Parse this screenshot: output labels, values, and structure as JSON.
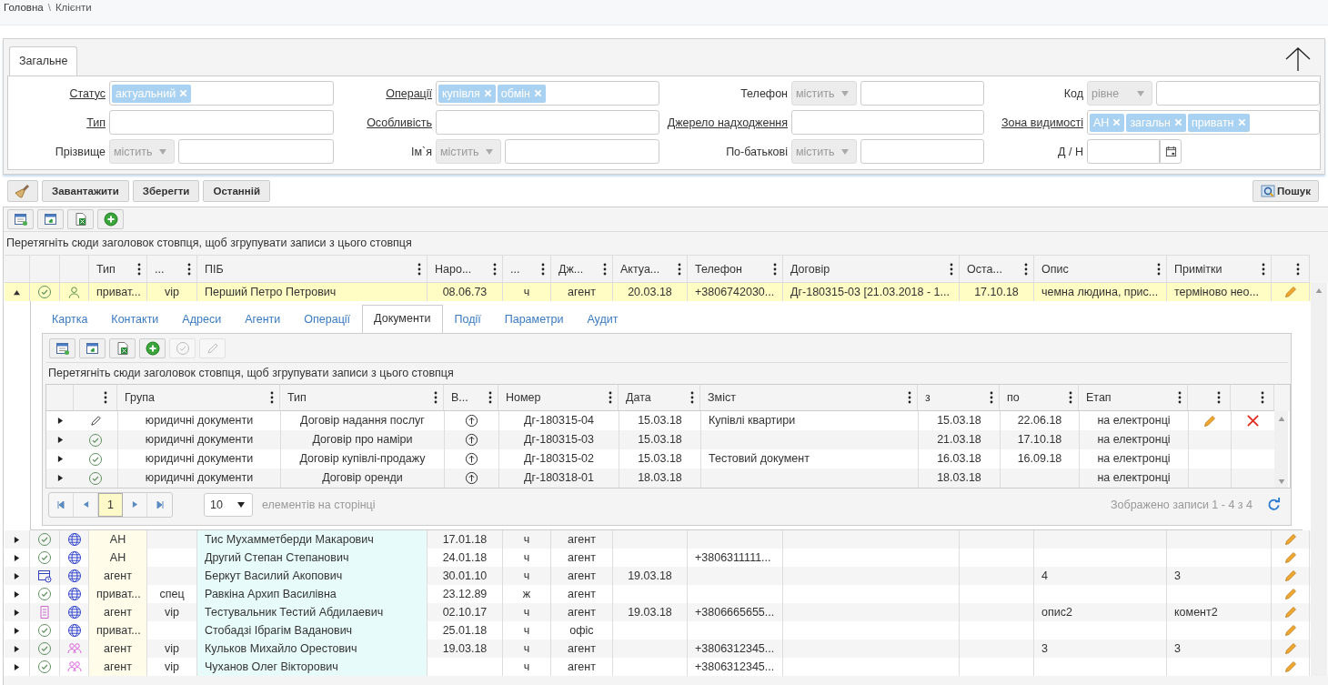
{
  "breadcrumb": [
    {
      "text": "Головна",
      "kind": "link"
    },
    {
      "text": "\\",
      "kind": "separator"
    },
    {
      "text": "Клієнти",
      "kind": "current"
    }
  ],
  "filter": {
    "tab": "Загальне",
    "fields": [
      {
        "label": "Статус",
        "link": true,
        "kind": "tags",
        "tags": [
          "актуальний"
        ]
      },
      {
        "label": "Операції",
        "link": true,
        "kind": "tags",
        "tags": [
          "купівля",
          "обмін"
        ]
      },
      {
        "label": "Телефон",
        "link": false,
        "kind": "op",
        "op": "містить"
      },
      {
        "label": "Код",
        "link": false,
        "kind": "op",
        "op": "рівне"
      },
      {
        "label": "Тип",
        "link": true,
        "kind": "text"
      },
      {
        "label": "Особливість",
        "link": true,
        "kind": "text"
      },
      {
        "label": "Джерело надходження",
        "link": true,
        "kind": "text"
      },
      {
        "label": "Зона видимості",
        "link": true,
        "kind": "tags",
        "tags": [
          "АН",
          "загальн",
          "приватн"
        ]
      },
      {
        "label": "Прізвище",
        "link": false,
        "kind": "op",
        "op": "містить"
      },
      {
        "label": "Ім`я",
        "link": false,
        "kind": "op",
        "op": "містить"
      },
      {
        "label": "По-батькові",
        "link": false,
        "kind": "op",
        "op": "містить"
      },
      {
        "label": "Д / Н",
        "link": false,
        "kind": "date"
      }
    ]
  },
  "actions": {
    "buttons": [
      "Завантажити",
      "Зберегти",
      "Останній"
    ],
    "search": "Пошук"
  },
  "toolbar": [
    {
      "kind": "settings"
    },
    {
      "kind": "add-window"
    },
    {
      "kind": "excel"
    },
    {
      "kind": "add"
    }
  ],
  "group_hint": "Перетягніть сюди заголовок стовпця, щоб згрупувати записи з цього стовпця",
  "columns": [
    "Тип",
    "...",
    "ПІБ",
    "Наро...",
    "...",
    "Дж...",
    "Актуа...",
    "Телефон",
    "Договір",
    "Оста...",
    "Опис",
    "Примітки"
  ],
  "rows": [
    {
      "selected": true,
      "expanded": true,
      "status": {
        "kind": "check"
      },
      "avatar": {
        "kind": "person"
      },
      "cells": [
        "приват...",
        "vip",
        "Перший Петро Петрович",
        "08.06.73",
        "ч",
        "агент",
        "20.03.18",
        "+3806742030...",
        "Дг-180315-03 [21.03.2018 - 1...",
        "17.10.18",
        "чемна людина, прис...",
        "терміново нео..."
      ],
      "detail": {
        "tabs": [
          {
            "label": "Картка",
            "selected": false
          },
          {
            "label": "Контакти",
            "selected": false
          },
          {
            "label": "Адреси",
            "selected": false
          },
          {
            "label": "Агенти",
            "selected": false
          },
          {
            "label": "Операції",
            "selected": false
          },
          {
            "label": "Документи",
            "selected": true
          },
          {
            "label": "Події",
            "selected": false
          },
          {
            "label": "Параметри",
            "selected": false
          },
          {
            "label": "Аудит",
            "selected": false
          }
        ],
        "toolbar": [
          {
            "kind": "settings",
            "disabled": false
          },
          {
            "kind": "add-window",
            "disabled": false
          },
          {
            "kind": "excel",
            "disabled": false
          },
          {
            "kind": "add",
            "disabled": false
          },
          {
            "kind": "approve",
            "disabled": true
          },
          {
            "kind": "edit",
            "disabled": true
          }
        ],
        "group_hint": "Перетягніть сюди заголовок стовпця, щоб згрупувати записи з цього стовпця",
        "columns": [
          "Група",
          "Тип",
          "В...",
          "Номер",
          "Дата",
          "Зміст",
          "з",
          "по",
          "Етап"
        ],
        "rows": [
          {
            "status": {
              "kind": "edit"
            },
            "actions": true,
            "cells": [
              "юридичні документи",
              "Договір надання послуг",
              "",
              "Дг-180315-04",
              "15.03.18",
              "Купівлі квартири",
              "15.03.18",
              "22.06.18",
              "на електронці"
            ]
          },
          {
            "status": {
              "kind": "check"
            },
            "actions": false,
            "cells": [
              "юридичні документи",
              "Договір про наміри",
              "",
              "Дг-180315-03",
              "15.03.18",
              "",
              "21.03.18",
              "17.10.18",
              "на електронці"
            ]
          },
          {
            "status": {
              "kind": "check"
            },
            "actions": false,
            "cells": [
              "юридичні документи",
              "Договір купівлі-продажу",
              "",
              "Дг-180315-02",
              "15.03.18",
              "Тестовий документ",
              "16.03.18",
              "16.09.18",
              "на електронці"
            ]
          },
          {
            "status": {
              "kind": "check"
            },
            "actions": false,
            "cells": [
              "юридичні документи",
              "Договір оренди",
              "",
              "Дг-180318-01",
              "18.03.18",
              "",
              "18.03.18",
              "",
              "на електронці"
            ]
          }
        ],
        "pager": {
          "page": "1",
          "size": "10",
          "size_label": "елементів на сторінці",
          "summary": "Зображено записи 1 - 4 з 4"
        }
      }
    },
    {
      "selected": false,
      "expanded": false,
      "status": {
        "kind": "check"
      },
      "avatar": {
        "kind": "globe"
      },
      "cells": [
        "АН",
        "",
        "Тис Мухамметберди Макарович",
        "17.01.18",
        "ч",
        "агент",
        "",
        "",
        "",
        "",
        "",
        ""
      ]
    },
    {
      "selected": false,
      "expanded": false,
      "status": {
        "kind": "check"
      },
      "avatar": {
        "kind": "globe"
      },
      "cells": [
        "АН",
        "",
        "Другий Степан Степанович",
        "24.01.18",
        "ч",
        "агент",
        "",
        "+3806311111...",
        "",
        "",
        "",
        ""
      ]
    },
    {
      "selected": false,
      "expanded": false,
      "status": {
        "kind": "calendar"
      },
      "avatar": {
        "kind": "globe"
      },
      "cells": [
        "агент",
        "",
        "Беркут Василий Акопович",
        "30.01.10",
        "ч",
        "агент",
        "19.03.18",
        "",
        "",
        "",
        "4",
        "3"
      ]
    },
    {
      "selected": false,
      "expanded": false,
      "status": {
        "kind": "check"
      },
      "avatar": {
        "kind": "globe"
      },
      "cells": [
        "приват...",
        "спец",
        "Равкіна Архип Василівна",
        "23.12.89",
        "ж",
        "агент",
        "",
        "",
        "",
        "",
        "",
        ""
      ]
    },
    {
      "selected": false,
      "expanded": false,
      "status": {
        "kind": "document"
      },
      "avatar": {
        "kind": "globe"
      },
      "cells": [
        "агент",
        "vip",
        "Тестувальник Тестий Абдилаевич",
        "02.10.17",
        "ч",
        "агент",
        "19.03.18",
        "+3806665655...",
        "",
        "",
        "опис2",
        "комент2"
      ]
    },
    {
      "selected": false,
      "expanded": false,
      "status": {
        "kind": "check"
      },
      "avatar": {
        "kind": "globe"
      },
      "cells": [
        "приват...",
        "",
        "Стобадзі Ібрагім Ваданович",
        "25.01.18",
        "ч",
        "офіс",
        "",
        "",
        "",
        "",
        "",
        ""
      ]
    },
    {
      "selected": false,
      "expanded": false,
      "status": {
        "kind": "check"
      },
      "avatar": {
        "kind": "group"
      },
      "cells": [
        "агент",
        "vip",
        "Кульков Михайло Орестович",
        "19.03.18",
        "ч",
        "агент",
        "",
        "+3806312345...",
        "",
        "",
        "3",
        "3"
      ]
    },
    {
      "selected": false,
      "expanded": false,
      "status": {
        "kind": "check"
      },
      "avatar": {
        "kind": "group"
      },
      "cells": [
        "агент",
        "vip",
        "Чуханов Олег Вікторович",
        "",
        "ч",
        "агент",
        "",
        "+3806312345...",
        "",
        "",
        "",
        ""
      ]
    }
  ]
}
